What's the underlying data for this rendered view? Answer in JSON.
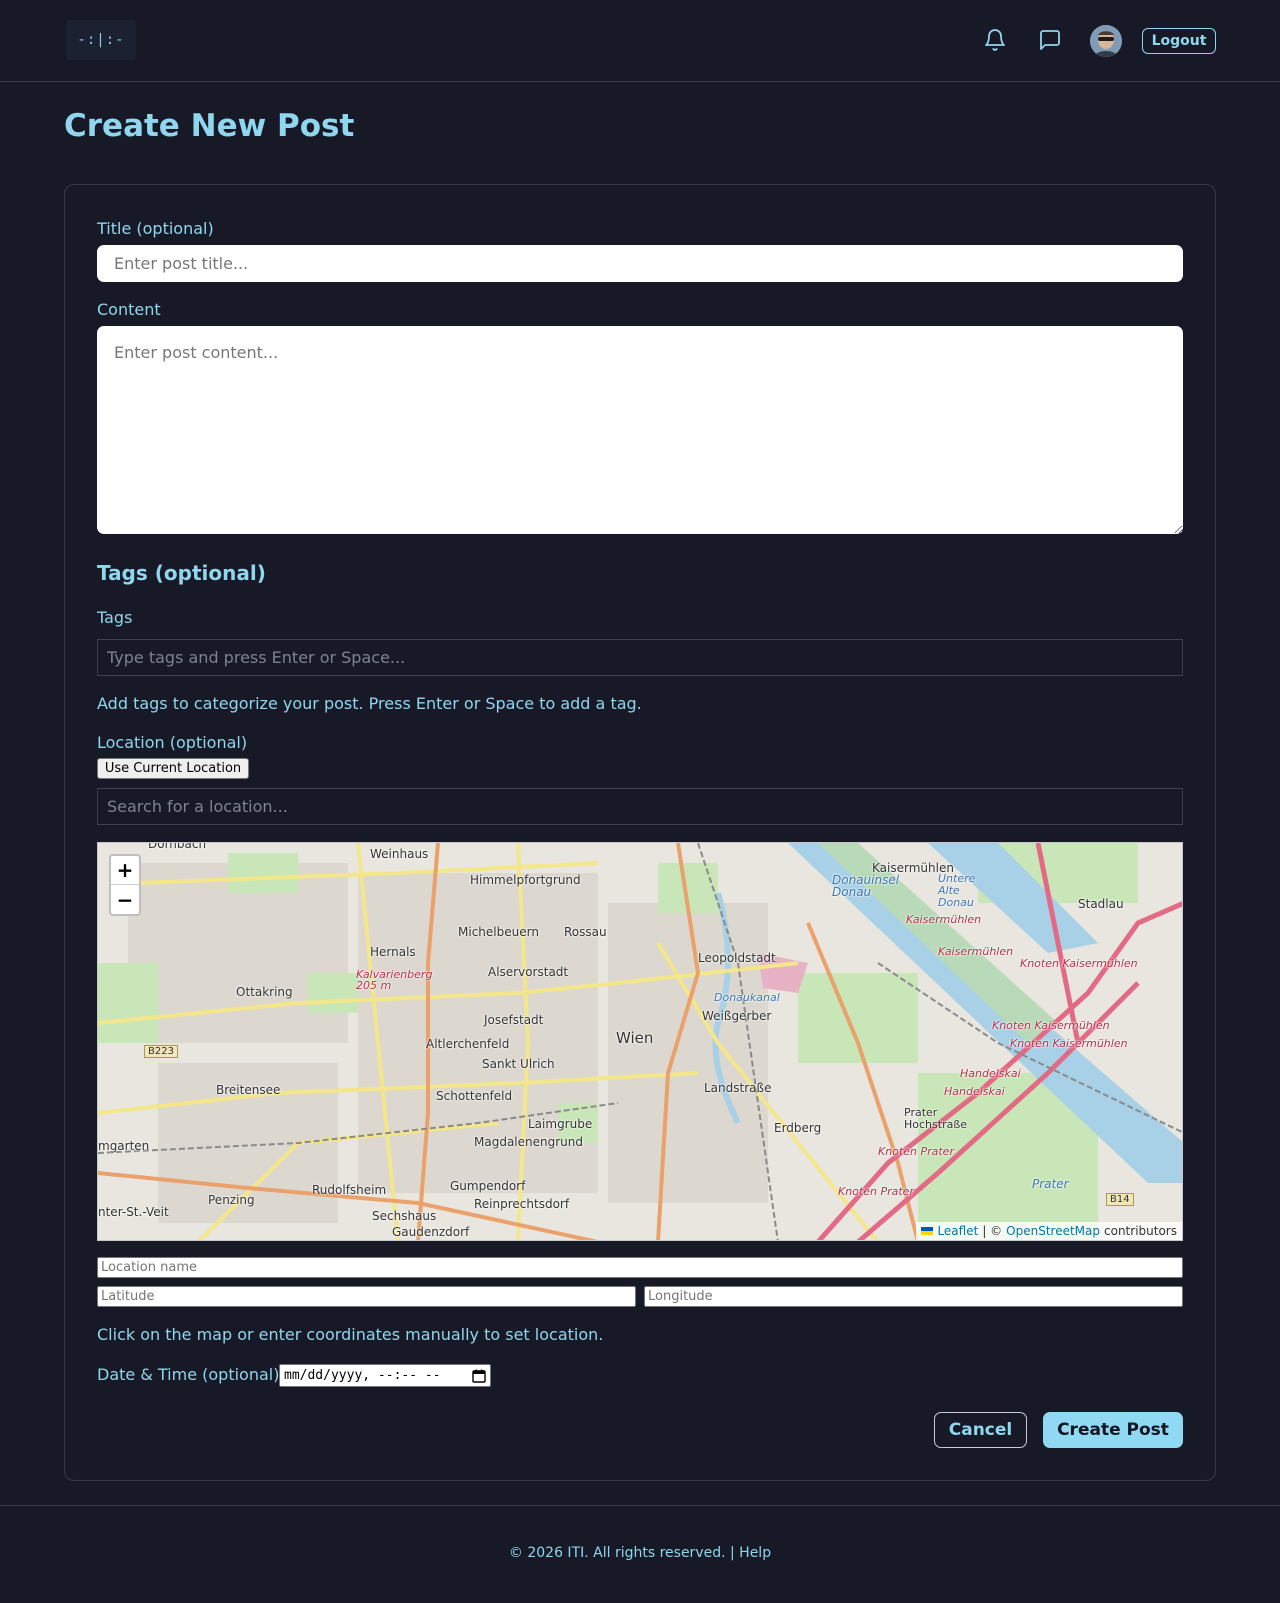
{
  "header": {
    "logo_text": "-:|:-",
    "logout_label": "Logout",
    "icons": [
      "bell-icon",
      "chat-icon"
    ]
  },
  "page": {
    "title": "Create New Post"
  },
  "form": {
    "title_label": "Title (optional)",
    "title_placeholder": "Enter post title...",
    "content_label": "Content",
    "content_placeholder": "Enter post content...",
    "tags_section_heading": "Tags (optional)",
    "tags_label": "Tags",
    "tags_placeholder": "Type tags and press Enter or Space...",
    "tags_help": "Add tags to categorize your post. Press Enter or Space to add a tag.",
    "location_label": "Location (optional)",
    "use_current_location_label": "Use Current Location",
    "location_search_placeholder": "Search for a location...",
    "location_name_placeholder": "Location name",
    "latitude_placeholder": "Latitude",
    "longitude_placeholder": "Longitude",
    "location_help": "Click on the map or enter coordinates manually to set location.",
    "datetime_label": "Date & Time (optional)",
    "datetime_value": "mm/dd/yyyy, --:-- --",
    "cancel_label": "Cancel",
    "create_label": "Create Post"
  },
  "map": {
    "zoom_in": "+",
    "zoom_out": "−",
    "attribution": {
      "leaflet": "Leaflet",
      "separator": "| ©",
      "osm": "OpenStreetMap",
      "contributors": "contributors"
    },
    "labels": {
      "wien": "Wien",
      "weinhaus": "Weinhaus",
      "himmelpfortgrund": "Himmelpfortgrund",
      "michelbeuern": "Michelbeuern",
      "rossau": "Rossau",
      "hernals": "Hernals",
      "alservorstadt": "Alservorstadt",
      "leopoldstadt": "Leopoldstadt",
      "ottakring": "Ottakring",
      "josefstadt": "Josefstadt",
      "weissgerber": "Weißgerber",
      "altlerchenfeld": "Altlerchenfeld",
      "sankt_ulrich": "Sankt Ulrich",
      "breitensee": "Breitensee",
      "schottenfeld": "Schottenfeld",
      "landstrasse": "Landstraße",
      "laimgrube": "Laimgrube",
      "magdalenengrund": "Magdalenengrund",
      "erdberg": "Erdberg",
      "gumpendorf": "Gumpendorf",
      "reinprechtsdorf": "Reinprechtsdorf",
      "rudolfsheim": "Rudolfsheim",
      "penzing": "Penzing",
      "sechshaus": "Sechshaus",
      "kaisermuehlen": "Kaisermühlen",
      "stadlau": "Stadlau",
      "donauinsel": "Donauinsel",
      "donau": "Donau",
      "prater": "Prater",
      "prater_hauptallee": "Prater Hochstraße",
      "handelskai": "Handelskai",
      "knoten_prater": "Knoten Prater",
      "knoten_kaisermuehlen": "Knoten Kaisermühlen",
      "kaisermuehlen_road": "Kaisermühlen",
      "b223": "B223",
      "b14": "B14",
      "dornbach": "Dornbach",
      "hutteldorf": "nter-St.-Veit",
      "baumgarten": "mgarten",
      "kalvarienberg": "Kalvarienberg 205 m",
      "untere_alte_donau": "Untere Alte Donau",
      "donaukanal": "Donaukanal",
      "gaudenzdorf": "Gaudenzdorf"
    }
  },
  "footer": {
    "text": "© 2026 ITI. All rights reserved. | Help"
  },
  "colors": {
    "background": "#171a26",
    "accent": "#8fd6ee",
    "primary_button": "#8fd9f2"
  }
}
